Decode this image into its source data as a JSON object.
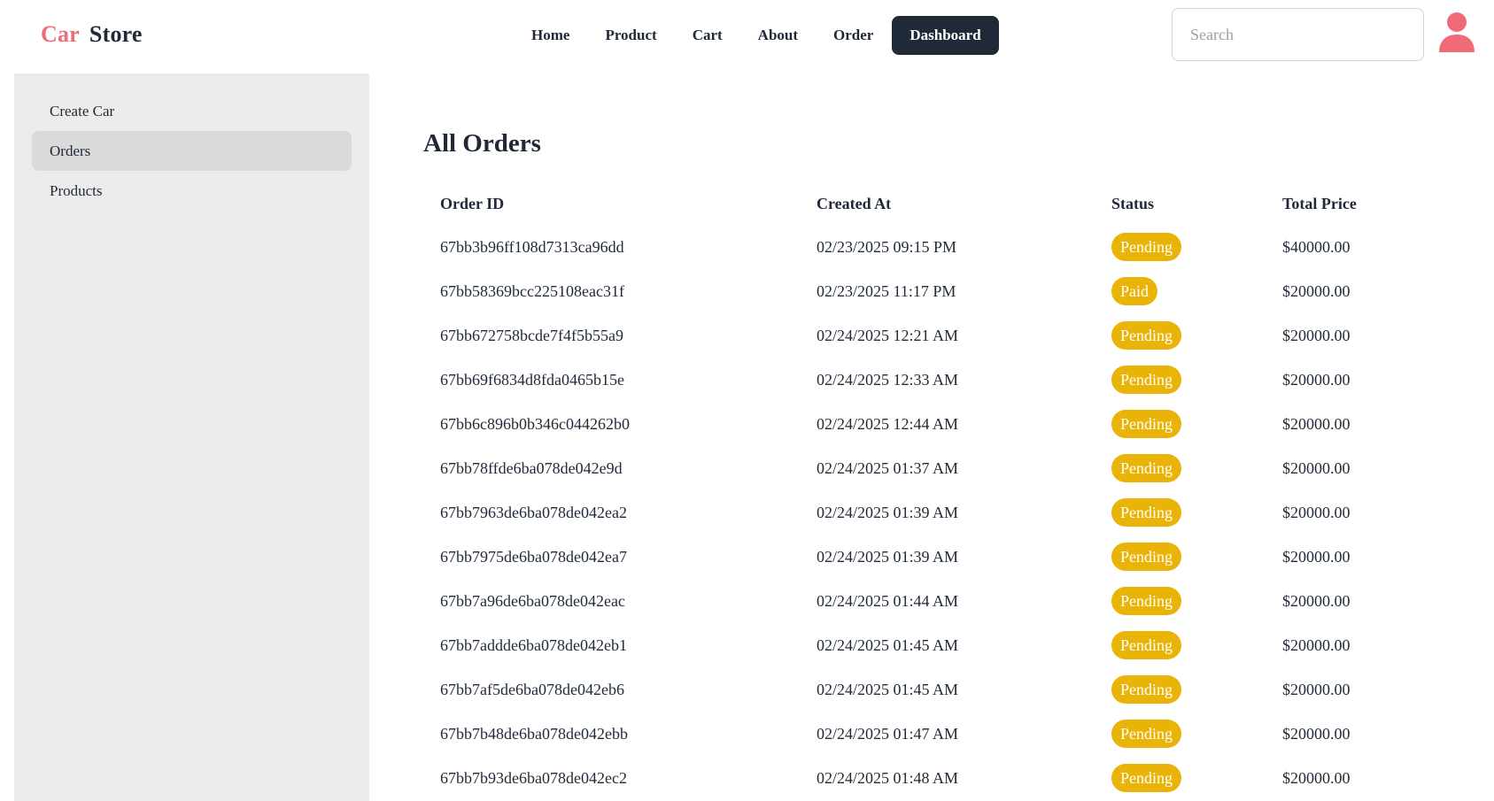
{
  "brand": {
    "part1": "Car",
    "part2": "Store"
  },
  "nav": {
    "items": [
      "Home",
      "Product",
      "Cart",
      "About",
      "Order"
    ],
    "active": "Dashboard"
  },
  "search": {
    "placeholder": "Search",
    "value": ""
  },
  "avatar_icon": "user-icon",
  "colors": {
    "brand_accent": "#f06a78",
    "dark": "#1f2937",
    "badge": "#eab308",
    "sidebar_bg": "#ececec"
  },
  "sidebar": {
    "items": [
      {
        "label": "Create Car"
      },
      {
        "label": "Orders",
        "active": true
      },
      {
        "label": "Products"
      }
    ]
  },
  "main": {
    "title": "All Orders",
    "columns": [
      "Order ID",
      "Created At",
      "Status",
      "Total Price"
    ],
    "rows": [
      [
        "67bb3b96ff108d7313ca96dd",
        "02/23/2025 09:15 PM",
        "Pending",
        "$40000.00"
      ],
      [
        "67bb58369bcc225108eac31f",
        "02/23/2025 11:17 PM",
        "Paid",
        "$20000.00"
      ],
      [
        "67bb672758bcde7f4f5b55a9",
        "02/24/2025 12:21 AM",
        "Pending",
        "$20000.00"
      ],
      [
        "67bb69f6834d8fda0465b15e",
        "02/24/2025 12:33 AM",
        "Pending",
        "$20000.00"
      ],
      [
        "67bb6c896b0b346c044262b0",
        "02/24/2025 12:44 AM",
        "Pending",
        "$20000.00"
      ],
      [
        "67bb78ffde6ba078de042e9d",
        "02/24/2025 01:37 AM",
        "Pending",
        "$20000.00"
      ],
      [
        "67bb7963de6ba078de042ea2",
        "02/24/2025 01:39 AM",
        "Pending",
        "$20000.00"
      ],
      [
        "67bb7975de6ba078de042ea7",
        "02/24/2025 01:39 AM",
        "Pending",
        "$20000.00"
      ],
      [
        "67bb7a96de6ba078de042eac",
        "02/24/2025 01:44 AM",
        "Pending",
        "$20000.00"
      ],
      [
        "67bb7addde6ba078de042eb1",
        "02/24/2025 01:45 AM",
        "Pending",
        "$20000.00"
      ],
      [
        "67bb7af5de6ba078de042eb6",
        "02/24/2025 01:45 AM",
        "Pending",
        "$20000.00"
      ],
      [
        "67bb7b48de6ba078de042ebb",
        "02/24/2025 01:47 AM",
        "Pending",
        "$20000.00"
      ],
      [
        "67bb7b93de6ba078de042ec2",
        "02/24/2025 01:48 AM",
        "Pending",
        "$20000.00"
      ]
    ]
  }
}
